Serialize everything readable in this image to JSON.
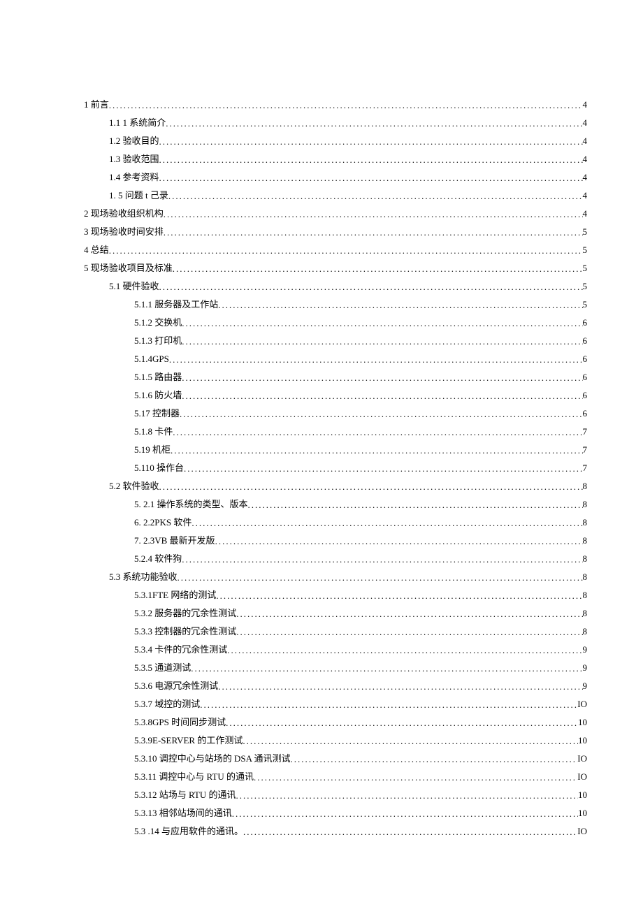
{
  "toc": [
    {
      "level": 0,
      "label": "1   前言",
      "page": "4"
    },
    {
      "level": 1,
      "label": "1.1 1 系统简介",
      "page": "4"
    },
    {
      "level": 1,
      "label": "1.2    验收目的",
      "page": "4"
    },
    {
      "level": 1,
      "label": "1.3    验收范围",
      "page": "4"
    },
    {
      "level": 1,
      "label": "1.4     参考资料",
      "page": "4"
    },
    {
      "level": 1,
      "label": "1.   5 问题 t 己录",
      "page": "4"
    },
    {
      "level": 0,
      "label": "2 现场验收组织机构",
      "page": "4"
    },
    {
      "level": 0,
      "label": "3 现场验收时间安排",
      "page": "5"
    },
    {
      "level": 0,
      "label": "4 总结",
      "page": "5"
    },
    {
      "level": 0,
      "label": "5 现场验收项目及标准",
      "page": "5"
    },
    {
      "level": 1,
      "label": "5.1 硬件验收",
      "page": "5"
    },
    {
      "level": 2,
      "label": "5.1.1 服务器及工作站",
      "page": "5"
    },
    {
      "level": 2,
      "label": "5.1.2 交换机",
      "page": "6"
    },
    {
      "level": 2,
      "label": "5.1.3 打印机",
      "page": "6"
    },
    {
      "level": 2,
      "label": "5.1.4GPS",
      "page": "6"
    },
    {
      "level": 2,
      "label": "5.1.5 路由器",
      "page": "6"
    },
    {
      "level": 2,
      "label": "5.1.6 防火墙",
      "page": "6"
    },
    {
      "level": 2,
      "label": "5.17 控制器",
      "page": "6"
    },
    {
      "level": 2,
      "label": "5.1.8 卡件",
      "page": "7"
    },
    {
      "level": 2,
      "label": "5.19 机柜",
      "page": "7"
    },
    {
      "level": 2,
      "label": "5.110 操作台",
      "page": "7"
    },
    {
      "level": 1,
      "label": "5.2 软件验收",
      "page": "8"
    },
    {
      "level": 2,
      "label": "5.   2.1 操作系统的类型、版本",
      "page": "8"
    },
    {
      "level": 2,
      "label": "6.   2.2PKS 软件",
      "page": "8"
    },
    {
      "level": 2,
      "label": "7.   2.3VB 最新开发版",
      "page": "8"
    },
    {
      "level": 2,
      "label": "5.2.4 软件狗",
      "page": "8"
    },
    {
      "level": 1,
      "label": "5.3 系统功能验收",
      "page": "8"
    },
    {
      "level": 2,
      "label": "5.3.1FTE 网络的测试",
      "page": "8"
    },
    {
      "level": 2,
      "label": "5.3.2 服务器的冗余性测试",
      "page": "8"
    },
    {
      "level": 2,
      "label": "5.3.3 控制器的冗余性测试",
      "page": "8"
    },
    {
      "level": 2,
      "label": "5.3.4 卡件的冗余性测试",
      "page": "9"
    },
    {
      "level": 2,
      "label": "5.3.5 通道测试",
      "page": "9"
    },
    {
      "level": 2,
      "label": "5.3.6 电源冗余性测试",
      "page": "9"
    },
    {
      "level": 2,
      "label": "5.3.7 域控的测试",
      "page": "IO"
    },
    {
      "level": 2,
      "label": "5.3.8GPS 时间同步测试",
      "page": "10"
    },
    {
      "level": 2,
      "label": "5.3.9E-SERVER 的工作测试",
      "page": "10"
    },
    {
      "level": 2,
      "label": "5.3.10 调控中心与站场的 DSA 通讯测试",
      "page": "IO"
    },
    {
      "level": 2,
      "label": "5.3.11 调控中心与 RTU 的通讯",
      "page": "IO"
    },
    {
      "level": 2,
      "label": "5.3.12 站场与 RTU 的通讯",
      "page": "10"
    },
    {
      "level": 2,
      "label": "5.3.13 相邻站场间的通讯",
      "page": "10"
    },
    {
      "level": 2,
      "label": "5.3    .14 与应用软件的通讯。",
      "page": "IO"
    }
  ]
}
